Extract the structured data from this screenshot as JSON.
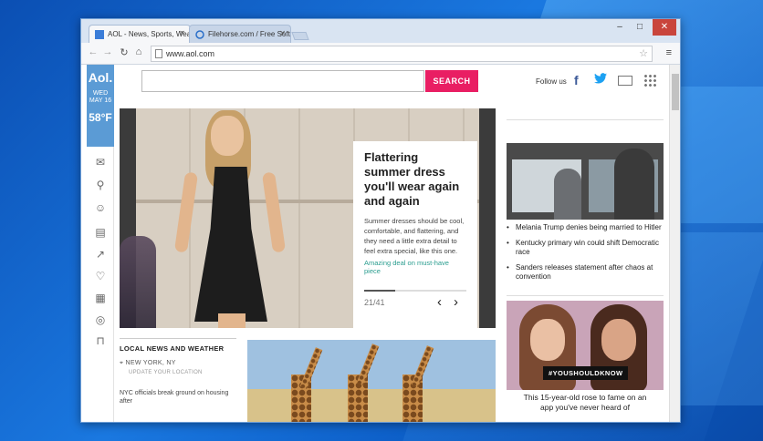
{
  "browser": {
    "tabs": [
      {
        "label": "AOL - News, Sports, Wea",
        "active": true
      },
      {
        "label": "Filehorse.com / Free Soft",
        "active": false
      }
    ],
    "url": "www.aol.com",
    "window_controls": [
      "minimize",
      "maximize",
      "close"
    ]
  },
  "aol": {
    "logo": "Aol.",
    "day": "WED",
    "date": "MAY 16",
    "temp": "58°F",
    "rail_icons": [
      "mail-icon",
      "search-icon",
      "user-icon",
      "video-icon",
      "chart-icon",
      "heart-icon",
      "news-icon",
      "football-icon",
      "shopping-bag-icon"
    ],
    "search_button": "SEARCH",
    "follow_label": "Follow us",
    "social": {
      "facebook": "f"
    }
  },
  "hero": {
    "title": "Flattering summer dress you'll wear again and again",
    "text": "Summer dresses should be cool, comfortable, and flattering, and they need a little extra detail to feel extra special, like this one.",
    "link": "Amazing deal on must-have piece",
    "count": "21/41"
  },
  "news": {
    "items": [
      "Melania Trump denies being married to Hitler",
      "Kentucky primary win could shift Democratic race",
      "Sanders releases statement after chaos at convention"
    ]
  },
  "promo": {
    "hashtag": "#YOUSHOULDKNOW",
    "text": "This 15-year-old rose to fame on an app you've never heard of"
  },
  "local": {
    "title": "LOCAL NEWS AND WEATHER",
    "city": "NEW YORK, NY",
    "update": "UPDATE YOUR LOCATION",
    "story": "NYC officials break ground on housing after"
  },
  "colors": {
    "accent": "#e91e63",
    "aol_blue": "#5b9bd5",
    "link": "#2a9d8f"
  }
}
